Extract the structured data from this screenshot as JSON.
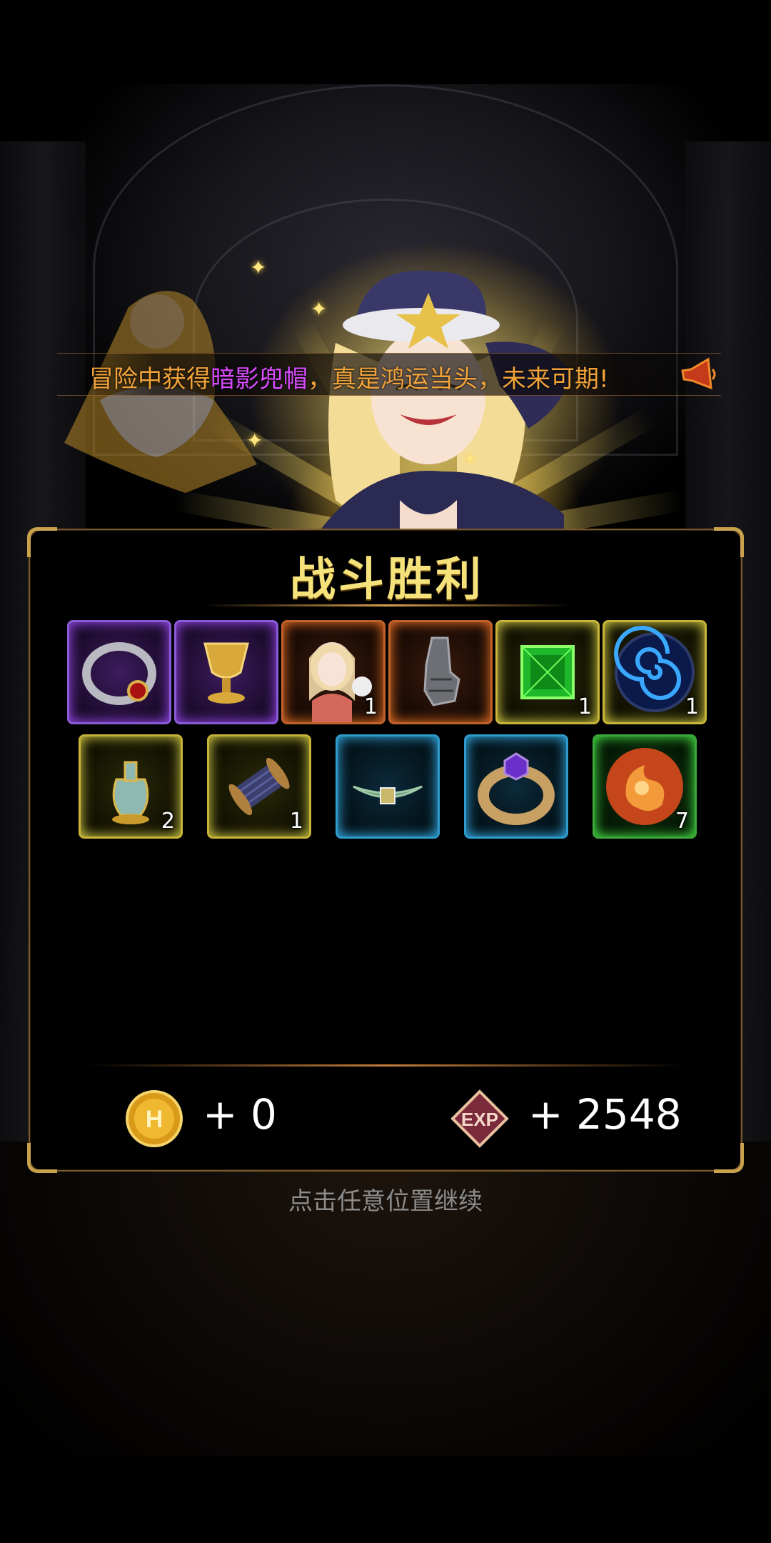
{
  "announcement": {
    "prefix": "冒险中获得",
    "item": "暗影兜帽",
    "suffix": "，真是鸿运当头，未来可期!"
  },
  "panel": {
    "title": "战斗胜利"
  },
  "rewards_row1": [
    {
      "icon": "silver-ring-icon",
      "quality": "purple",
      "count": ""
    },
    {
      "icon": "golden-chalice-icon",
      "quality": "purple",
      "count": ""
    },
    {
      "icon": "hero-portrait-icon",
      "quality": "orange",
      "count": "1"
    },
    {
      "icon": "steel-gauntlet-icon",
      "quality": "orange",
      "count": ""
    },
    {
      "icon": "green-gem-icon",
      "quality": "yellow",
      "count": "1"
    },
    {
      "icon": "blue-swirl-orb-icon",
      "quality": "yellow",
      "count": "1"
    }
  ],
  "rewards_row2": [
    {
      "icon": "potion-bottle-icon",
      "quality": "yellow",
      "count": "2"
    },
    {
      "icon": "thread-spool-icon",
      "quality": "yellow",
      "count": "1"
    },
    {
      "icon": "jade-collar-icon",
      "quality": "cyan",
      "count": ""
    },
    {
      "icon": "amethyst-ring-icon",
      "quality": "cyan",
      "count": ""
    },
    {
      "icon": "fire-orb-icon",
      "quality": "green",
      "count": "7"
    }
  ],
  "currency": {
    "gold_icon": "gold-coin-icon",
    "gold_value": "+ 0",
    "exp_icon": "exp-badge-icon",
    "exp_value": "+ 2548"
  },
  "footer": {
    "continue_text": "点击任意位置继续"
  },
  "colors": {
    "announcement": "#f2a33a",
    "item_highlight": "#d94bff",
    "title": "#f6e27a",
    "panel_border": "#c9a24e"
  }
}
